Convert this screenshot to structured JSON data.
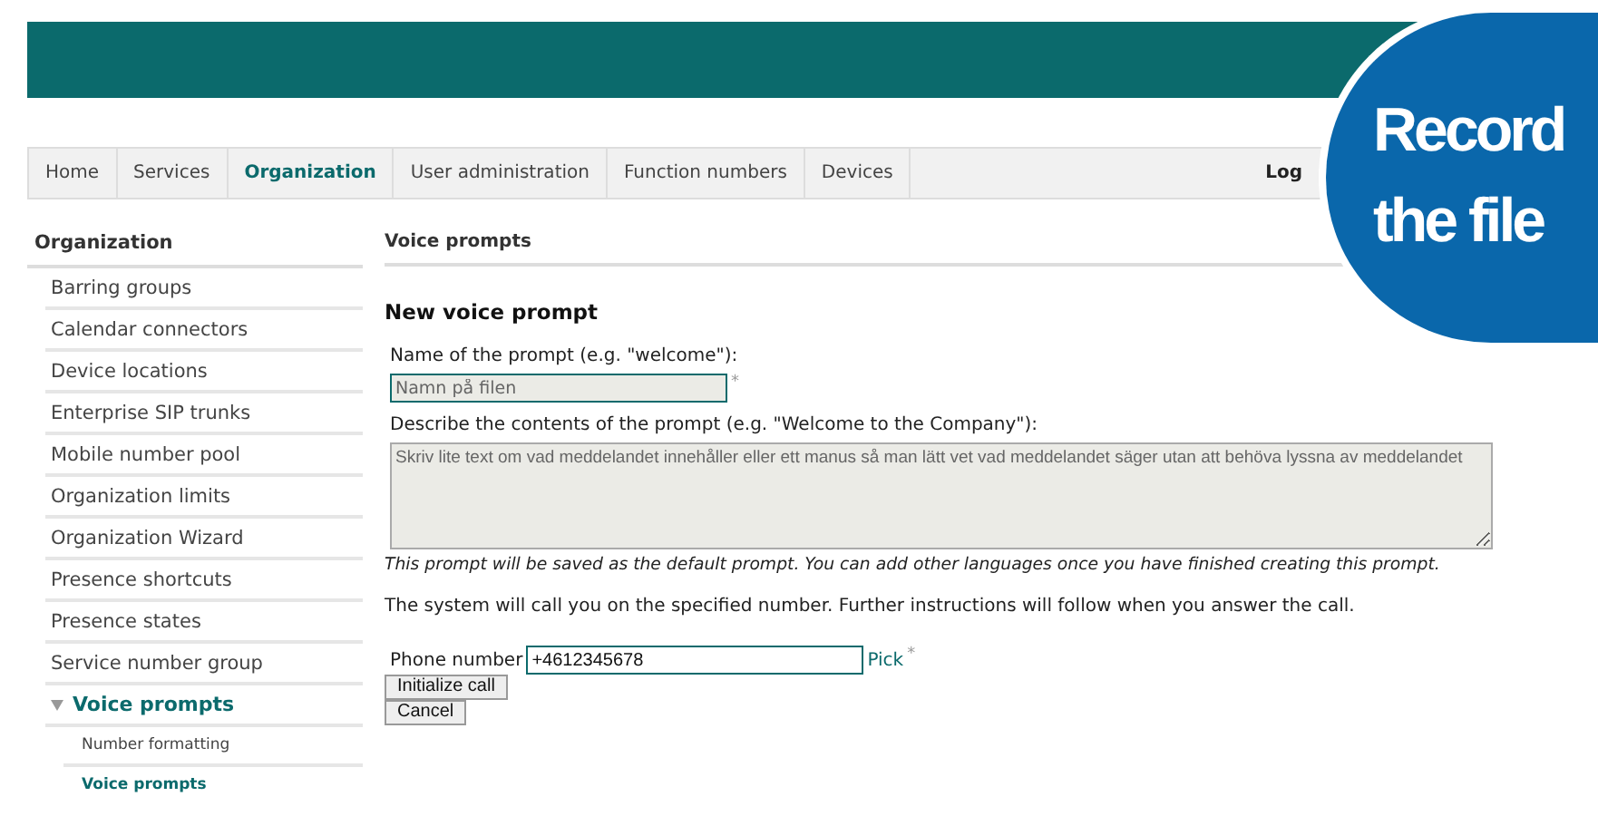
{
  "nav": {
    "tabs": [
      {
        "label": "Home",
        "selected": false
      },
      {
        "label": "Services",
        "selected": false
      },
      {
        "label": "Organization",
        "selected": true
      },
      {
        "label": "User administration",
        "selected": false
      },
      {
        "label": "Function numbers",
        "selected": false
      },
      {
        "label": "Devices",
        "selected": false
      }
    ],
    "login": "Log"
  },
  "sidebar": {
    "title": "Organization",
    "items": [
      {
        "label": "Barring groups",
        "selected": false
      },
      {
        "label": "Calendar connectors",
        "selected": false
      },
      {
        "label": "Device locations",
        "selected": false
      },
      {
        "label": "Enterprise SIP trunks",
        "selected": false
      },
      {
        "label": "Mobile number pool",
        "selected": false
      },
      {
        "label": "Organization limits",
        "selected": false
      },
      {
        "label": "Organization Wizard",
        "selected": false
      },
      {
        "label": "Presence shortcuts",
        "selected": false
      },
      {
        "label": "Presence states",
        "selected": false
      },
      {
        "label": "Service number group",
        "selected": false
      },
      {
        "label": "Voice prompts",
        "selected": true,
        "expanded": true,
        "children": [
          {
            "label": "Number formatting",
            "selected": false
          },
          {
            "label": "Voice prompts",
            "selected": true
          }
        ]
      }
    ]
  },
  "main": {
    "title": "Voice prompts",
    "heading": "New voice prompt",
    "name_label": "Name of the prompt (e.g. \"welcome\"):",
    "name_value": "Namn på filen",
    "name_required": "*",
    "description_label": "Describe the contents of the prompt (e.g. \"Welcome to the Company\"):",
    "description_value": "Skriv lite text om vad meddelandet innehåller eller ett manus så man lätt vet vad meddelandet säger utan att behöva lyssna av meddelandet",
    "note": "This prompt will be saved as the default prompt. You can add other languages once you have finished creating this prompt.",
    "instructions": "The system will call you on the specified number. Further instructions will follow when you answer the call.",
    "phone_label": "Phone number",
    "phone_value": "+4612345678",
    "pick_link": "Pick",
    "phone_required": "*",
    "buttons": [
      "Initialize call",
      "Cancel"
    ]
  },
  "callout": {
    "text": "Record the file"
  }
}
